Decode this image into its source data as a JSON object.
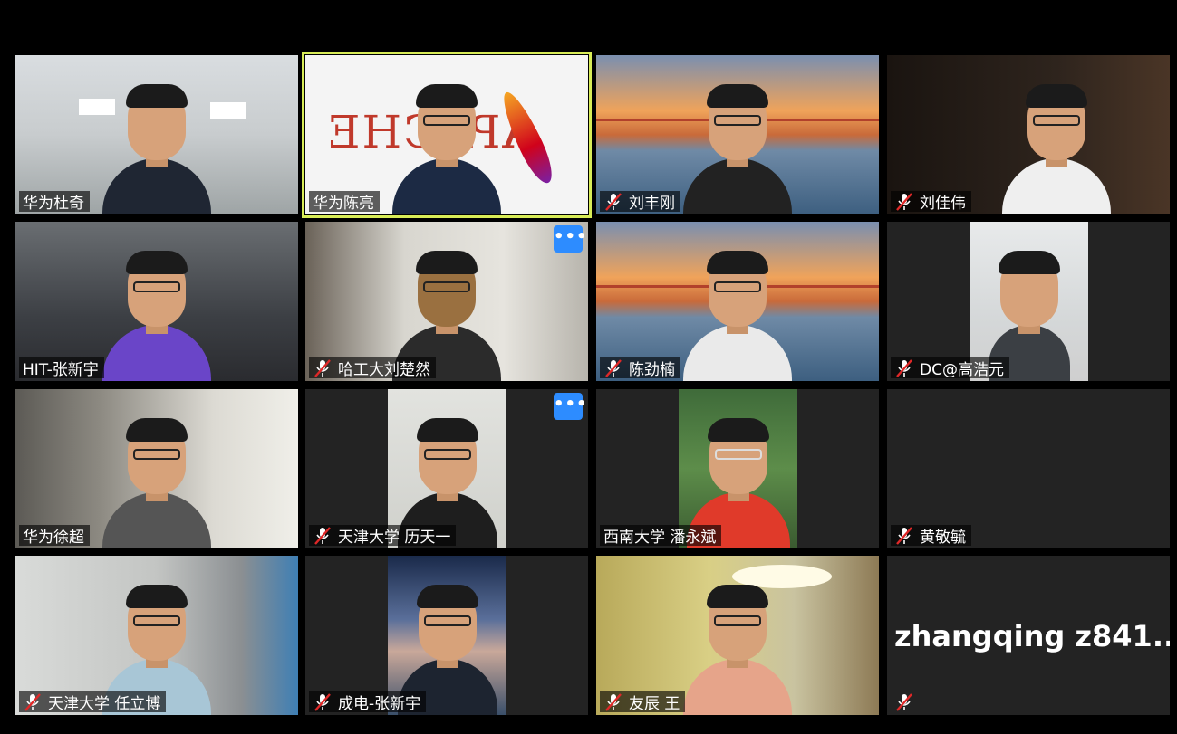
{
  "participants": [
    {
      "name": "华为杜奇",
      "muted": false
    },
    {
      "name": "华为陈亮",
      "muted": false,
      "active_speaker": true
    },
    {
      "name": "刘丰刚",
      "muted": true
    },
    {
      "name": "刘佳伟",
      "muted": true
    },
    {
      "name": "HIT-张新宇",
      "muted": false
    },
    {
      "name": "哈工大刘楚然",
      "muted": true,
      "more_button": "•••"
    },
    {
      "name": "陈劲楠",
      "muted": true
    },
    {
      "name": "DC@高浩元",
      "muted": true
    },
    {
      "name": "华为徐超",
      "muted": false
    },
    {
      "name": "天津大学 历天一",
      "muted": true,
      "more_button": "•••"
    },
    {
      "name": "西南大学 潘永斌",
      "muted": false
    },
    {
      "name": "黄敬毓",
      "muted": true,
      "video": "off"
    },
    {
      "name": "天津大学 任立博",
      "muted": true
    },
    {
      "name": "成电-张新宇",
      "muted": true
    },
    {
      "name": "友辰 王",
      "muted": true
    },
    {
      "name": "",
      "muted": true,
      "video": "off",
      "display_name": "zhangqing  z841..."
    }
  ],
  "icons": {
    "mute": "mic-muted-icon",
    "more": "more-options-icon"
  },
  "colors": {
    "active_border": "#d8ec57",
    "more_button": "#2d8cff",
    "mute_slash": "#e02828",
    "tile_bg": "#232323"
  },
  "apache_logo_text": "APACHE"
}
